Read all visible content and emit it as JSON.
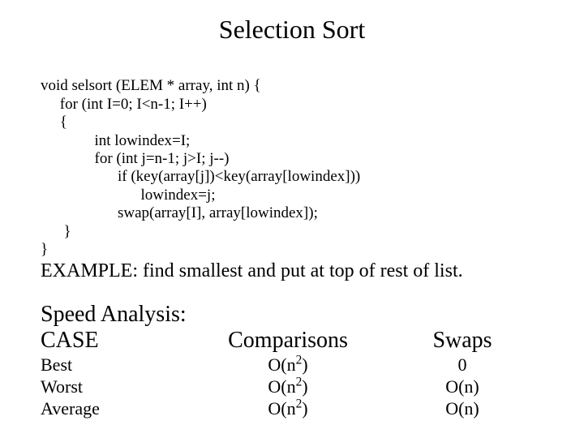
{
  "title": "Selection Sort",
  "code": {
    "l1": "void selsort (ELEM * array, int n) {",
    "l2": "     for (int I=0; I<n-1; I++)",
    "l3": "     {",
    "l4": "              int lowindex=I;",
    "l5": "              for (int j=n-1; j>I; j--)",
    "l6": "                    if (key(array[j])<key(array[lowindex]))",
    "l7": "                          lowindex=j;",
    "l8": "                    swap(array[I], array[lowindex]);",
    "l9": "      }",
    "l10": "}"
  },
  "example": "EXAMPLE: find smallest and put at top of rest of list.",
  "analysis": {
    "heading": "Speed Analysis:",
    "cols": {
      "case": "CASE",
      "comp": "Comparisons",
      "swap": "Swaps"
    },
    "rows": {
      "best": {
        "case": "Best",
        "comp_base": "O(n",
        "comp_sup": "2",
        "comp_tail": ")",
        "swap": "0"
      },
      "worst": {
        "case": "Worst",
        "comp_base": "O(n",
        "comp_sup": "2",
        "comp_tail": ")",
        "swap": "O(n)"
      },
      "average": {
        "case": "Average",
        "comp_base": "O(n",
        "comp_sup": "2",
        "comp_tail": ")",
        "swap": "O(n)"
      }
    }
  }
}
